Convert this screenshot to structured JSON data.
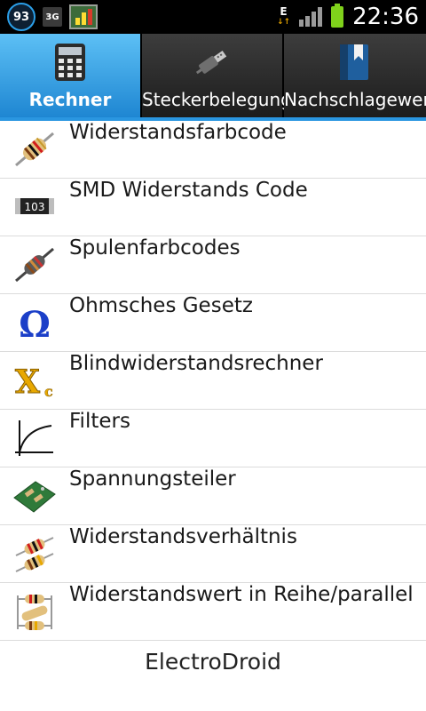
{
  "status_bar": {
    "notification_count": "93",
    "network_type": "3G",
    "data_indicator": "E",
    "time": "22:36"
  },
  "tabs": [
    {
      "label": "Rechner",
      "icon": "calculator-icon",
      "active": true
    },
    {
      "label": "Steckerbelegung",
      "icon": "usb-plug-icon",
      "active": false
    },
    {
      "label": "Nachschlagewerk",
      "icon": "book-icon",
      "active": false
    }
  ],
  "menu": [
    {
      "label": "Widerstandsfarbcode",
      "icon": "resistor-icon"
    },
    {
      "label": "SMD Widerstands Code",
      "icon": "smd-resistor-icon",
      "icon_text": "103"
    },
    {
      "label": "Spulenfarbcodes",
      "icon": "inductor-icon"
    },
    {
      "label": "Ohmsches Gesetz",
      "icon": "omega-icon",
      "icon_text": "Ω"
    },
    {
      "label": "Blindwiderstandsrechner",
      "icon": "reactance-icon",
      "icon_text": "X",
      "icon_subtext": "c"
    },
    {
      "label": "Filters",
      "icon": "filter-curve-icon"
    },
    {
      "label": "Spannungsteiler",
      "icon": "voltage-divider-icon"
    },
    {
      "label": "Widerstandsverhältnis",
      "icon": "resistor-ratio-icon"
    },
    {
      "label": "Widerstandswert in Reihe/parallel",
      "icon": "series-parallel-icon"
    }
  ],
  "footer": {
    "app_name": "ElectroDroid"
  },
  "colors": {
    "accent": "#2a96e0",
    "status_bar": "#000000",
    "battery": "#7fd11b"
  }
}
